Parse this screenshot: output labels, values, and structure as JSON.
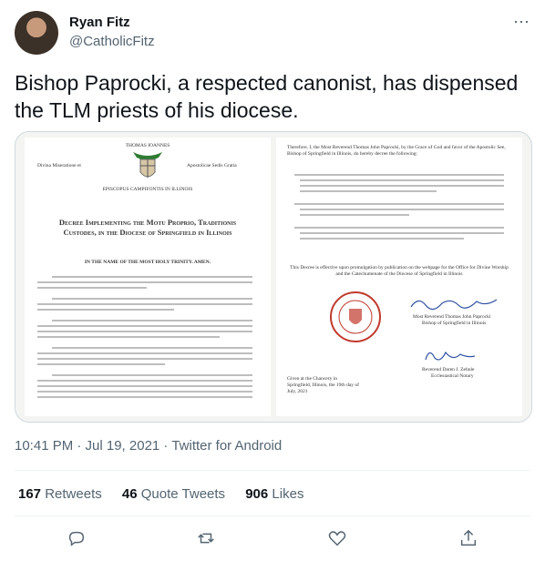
{
  "author": {
    "name": "Ryan Fitz",
    "handle": "@CatholicFitz"
  },
  "more_icon": "⋯",
  "tweet": {
    "text": "Bishop Paprocki, a respected canonist, has dispensed the TLM priests of his diocese."
  },
  "document": {
    "left": {
      "header_name": "THOMAS IOANNES",
      "left_motto": "Divina Miseratione et",
      "right_motto": "Apostolicae Sedis Gratia",
      "bishop_line": "EPISCOPUS CAMPIFONTIS IN ILLINOIS",
      "title": "Decree Implementing the Motu Proprio, Traditionis Custodes, in the Diocese of Springfield in Illinois",
      "invocation": "IN THE NAME OF THE MOST HOLY TRINITY. AMEN."
    },
    "right": {
      "intro": "Therefore, I, the Most Reverend Thomas John Paprocki, by the Grace of God and favor of the Apostolic See, Bishop of Springfield in Illinois, do hereby decree the following:",
      "effective": "This Decree is effective upon promulgation by publication on the webpage for the Office for Divine Worship and the Catechumenate of the Diocese of Springfield in Illinois",
      "signer1": "Most Reverend Thomas John Paprocki",
      "signer1_title": "Bishop of Springfield in Illinois",
      "signer2": "Reverend Daren J. Zehnle",
      "signer2_title": "Ecclesiastical Notary",
      "given": "Given at the Chancery in Springfield, Illinois, the 19th day of July, 2021"
    }
  },
  "meta": {
    "time": "10:41 PM · Jul 19, 2021 · ",
    "client": "Twitter for Android"
  },
  "stats": {
    "retweets_count": "167",
    "retweets_label": "Retweets",
    "quotes_count": "46",
    "quotes_label": "Quote Tweets",
    "likes_count": "906",
    "likes_label": "Likes"
  },
  "actions": {
    "reply_icon": "reply-icon",
    "retweet_icon": "retweet-icon",
    "like_icon": "heart-icon",
    "share_icon": "share-icon"
  },
  "colors": {
    "secondary": "#536471",
    "border": "#cfd9de",
    "seal": "#c0392b"
  }
}
